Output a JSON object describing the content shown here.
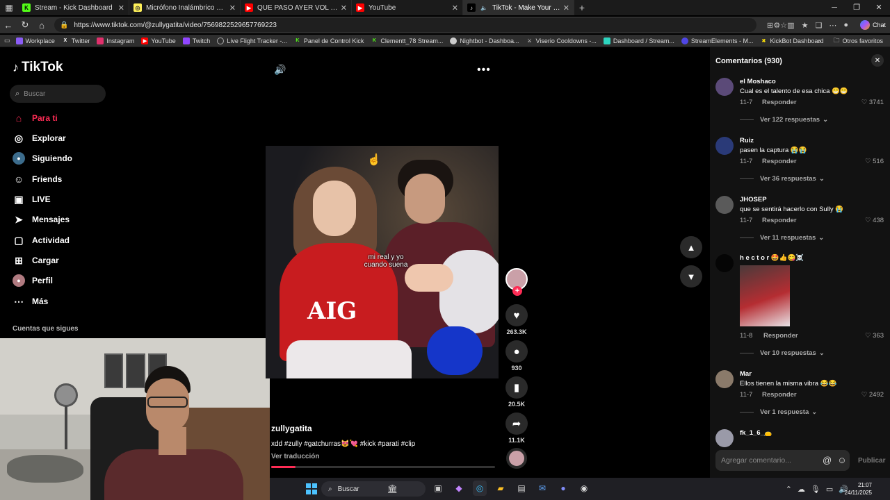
{
  "browser": {
    "tabs": [
      {
        "title": "Stream - Kick Dashboard",
        "icon": "kick-icon",
        "color": "#53fc18"
      },
      {
        "title": "Micrófono Inalámbrico Lavalier H",
        "icon": "mercado-icon",
        "color": "#fff159"
      },
      {
        "title": "QUE PASÓ AYER VOL 64 \"MIX SAL",
        "icon": "youtube-icon",
        "color": "#ff0000"
      },
      {
        "title": "YouTube",
        "icon": "youtube-icon",
        "color": "#ff0000"
      },
      {
        "title": "TikTok - Make Your Day",
        "icon": "tiktok-icon",
        "color": "#000000"
      }
    ],
    "url": "https://www.tiktok.com/@zullygatita/video/7569822529657769223",
    "copilot_label": "Chat",
    "bookmarks": [
      {
        "label": "Workplace",
        "color": "#8b5cf6"
      },
      {
        "label": "Twitter",
        "color": "#000000"
      },
      {
        "label": "Instagram",
        "color": "#e1306c"
      },
      {
        "label": "YouTube",
        "color": "#ff0000"
      },
      {
        "label": "Twitch",
        "color": "#9146ff"
      },
      {
        "label": "Live Flight Tracker -...",
        "color": "#888888"
      },
      {
        "label": "Panel de Control Kick",
        "color": "#53fc18"
      },
      {
        "label": "Clementt_78 Stream...",
        "color": "#53fc18"
      },
      {
        "label": "Nightbot - Dashboa...",
        "color": "#cccccc"
      },
      {
        "label": "Viserio Cooldowns -...",
        "color": "#aaaaaa"
      },
      {
        "label": "Dashboard / Stream...",
        "color": "#2dd4bf"
      },
      {
        "label": "StreamElements - M...",
        "color": "#4f46e5"
      },
      {
        "label": "KickBot Dashboard",
        "color": "#f5d90a"
      }
    ],
    "other_favorites": "Otros favoritos"
  },
  "tiktok": {
    "logo": "TikTok",
    "search_placeholder": "Buscar",
    "nav": [
      {
        "label": "Para ti",
        "icon": "home-icon"
      },
      {
        "label": "Explorar",
        "icon": "compass-icon"
      },
      {
        "label": "Siguiendo",
        "icon": "following-avatar-icon"
      },
      {
        "label": "Friends",
        "icon": "friends-icon"
      },
      {
        "label": "LIVE",
        "icon": "live-icon"
      },
      {
        "label": "Mensajes",
        "icon": "messages-icon"
      },
      {
        "label": "Actividad",
        "icon": "activity-icon"
      },
      {
        "label": "Cargar",
        "icon": "upload-icon"
      },
      {
        "label": "Perfil",
        "icon": "profile-icon"
      },
      {
        "label": "Más",
        "icon": "more-icon"
      }
    ],
    "following_title": "Cuentas que sigues",
    "video": {
      "caption_overlay_line1": "mi real y yo",
      "caption_overlay_line2": "cuando suena",
      "jersey_text": "AIG",
      "author": "zullygatita",
      "description": "xdd #zully #gatchurras😻💘 #kick #parati #clip",
      "translate": "Ver traducción",
      "progress": 0.11
    },
    "actions": {
      "likes": "263.3K",
      "comments": "930",
      "saves": "20.5K",
      "shares": "11.1K"
    },
    "comments_panel": {
      "title": "Comentarios (930)",
      "reply_label": "Responder",
      "add_placeholder": "Agregar comentario...",
      "publish_label": "Publicar",
      "items": [
        {
          "user": "el Moshaco",
          "text": "Cual es el talento de esa chica 😁😁",
          "date": "11-7",
          "likes": "3741",
          "view_replies": "Ver 122 respuestas"
        },
        {
          "user": "Ruiz",
          "text": "pasen la captura 😭😭",
          "date": "11-7",
          "likes": "516",
          "view_replies": "Ver 36 respuestas"
        },
        {
          "user": "JHOSEP",
          "text": "que se sentirá hacerlo con Sully 😭",
          "date": "11-7",
          "likes": "438",
          "view_replies": "Ver 11 respuestas"
        },
        {
          "user": "h e c t o r 🤩👍😋☠️",
          "text": "",
          "date": "11-8",
          "likes": "363",
          "view_replies": "Ver 10 respuestas"
        },
        {
          "user": "Mar",
          "text": "Ellos tienen la misma vibra 😂😂",
          "date": "11-7",
          "likes": "2492",
          "view_replies": "Ver 1 respuesta"
        },
        {
          "user": "fk_1_6_👝",
          "text": "",
          "date": "",
          "likes": "",
          "view_replies": ""
        }
      ]
    }
  },
  "taskbar": {
    "search": "Buscar",
    "time": "21:07",
    "date": "24/11/2025"
  }
}
